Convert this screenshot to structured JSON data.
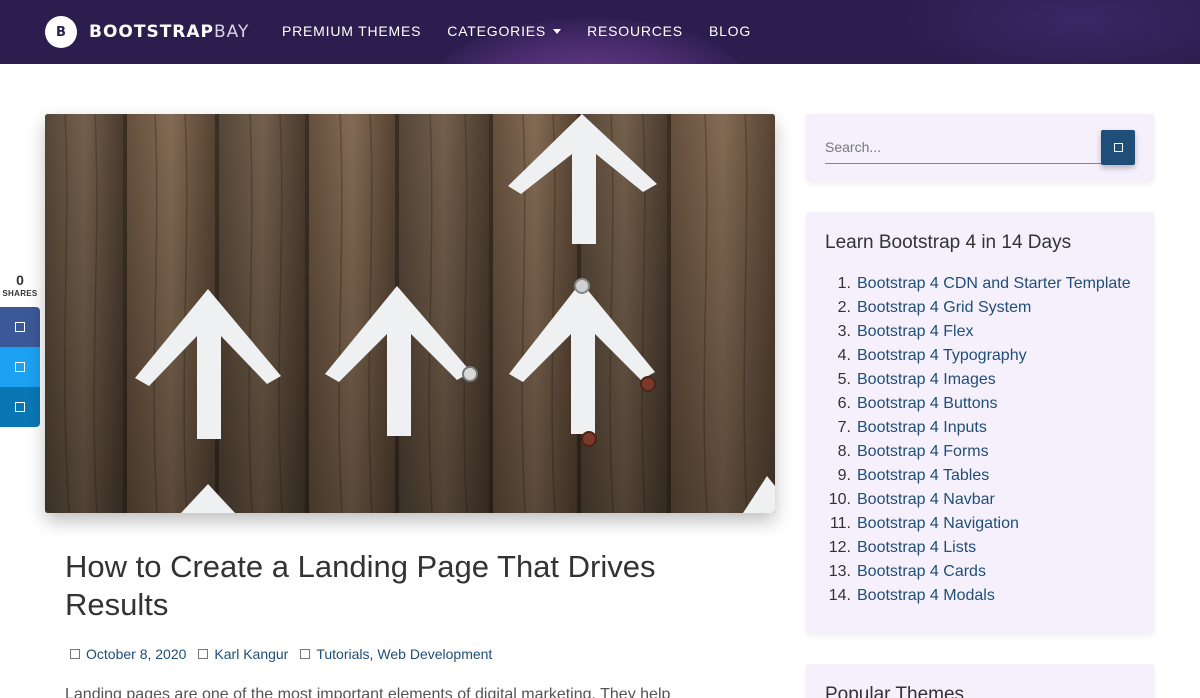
{
  "header": {
    "logo_letter": "B",
    "logo_bold": "BOOTSTRAP",
    "logo_thin": "BAY",
    "nav": [
      {
        "label": "PREMIUM THEMES"
      },
      {
        "label": "CATEGORIES"
      },
      {
        "label": "RESOURCES"
      },
      {
        "label": "BLOG"
      }
    ],
    "colors": {
      "background": "#2b1e4e",
      "text": "#ffffff"
    }
  },
  "share": {
    "count": "0",
    "label": "SHARES",
    "buttons": [
      {
        "network": "facebook",
        "icon": "facebook-icon",
        "color": "#3b5998"
      },
      {
        "network": "twitter",
        "icon": "twitter-icon",
        "color": "#1da1f2"
      },
      {
        "network": "linkedin",
        "icon": "linkedin-icon",
        "color": "#0a77b5"
      }
    ]
  },
  "article": {
    "image_alt": "White arrows on a wooden wall",
    "title": "How to Create a Landing Page That Drives Results",
    "date": "October 8, 2020",
    "author": "Karl Kangur",
    "categories": [
      "Tutorials",
      "Web Development"
    ],
    "category_separator": ",",
    "excerpt": "Landing pages are one of the most important elements of digital marketing. They help"
  },
  "sidebar": {
    "search": {
      "placeholder": "Search...",
      "value": "",
      "icon": "search-icon",
      "button_color": "#1f4e79"
    },
    "learn": {
      "title": "Learn Bootstrap 4 in 14 Days",
      "items": [
        {
          "num": "1.",
          "label": "Bootstrap 4 CDN and Starter Template"
        },
        {
          "num": "2.",
          "label": "Bootstrap 4 Grid System"
        },
        {
          "num": "3.",
          "label": "Bootstrap 4 Flex"
        },
        {
          "num": "4.",
          "label": "Bootstrap 4 Typography"
        },
        {
          "num": "5.",
          "label": "Bootstrap 4 Images"
        },
        {
          "num": "6.",
          "label": "Bootstrap 4 Buttons"
        },
        {
          "num": "7.",
          "label": "Bootstrap 4 Inputs"
        },
        {
          "num": "8.",
          "label": "Bootstrap 4 Forms"
        },
        {
          "num": "9.",
          "label": "Bootstrap 4 Tables"
        },
        {
          "num": "10.",
          "label": "Bootstrap 4 Navbar"
        },
        {
          "num": "11.",
          "label": "Bootstrap 4 Navigation"
        },
        {
          "num": "12.",
          "label": "Bootstrap 4 Lists"
        },
        {
          "num": "13.",
          "label": "Bootstrap 4 Cards"
        },
        {
          "num": "14.",
          "label": "Bootstrap 4 Modals"
        }
      ]
    },
    "popular": {
      "title": "Popular Themes"
    },
    "colors": {
      "widget_bg": "#f5f0fb",
      "link": "#1f4e79"
    }
  }
}
